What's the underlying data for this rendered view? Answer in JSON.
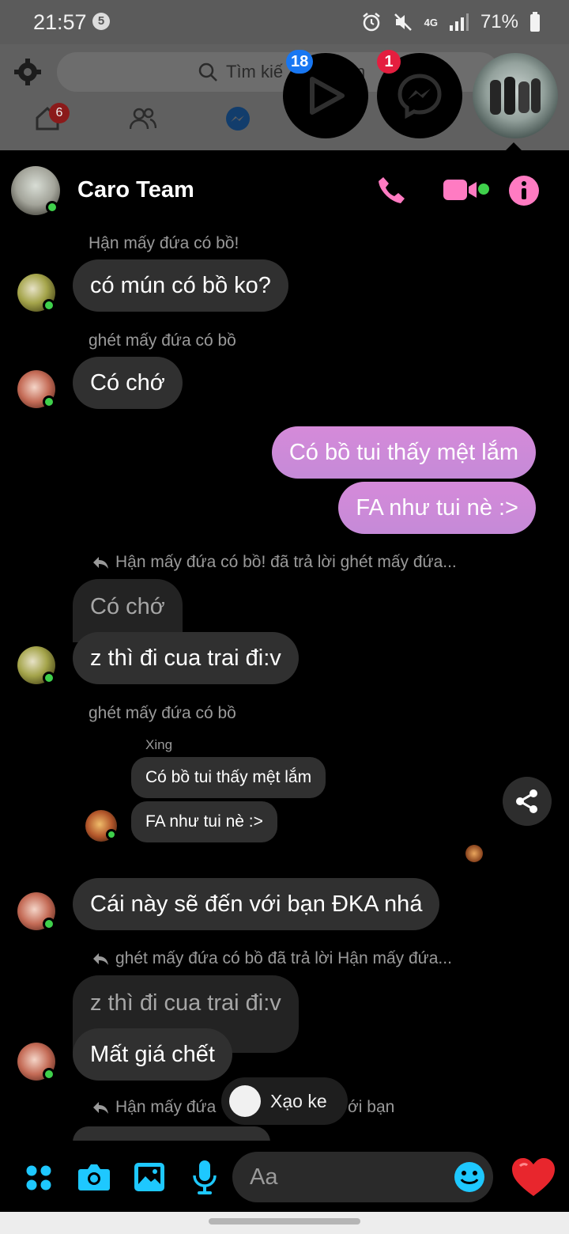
{
  "status_bar": {
    "time": "21:57",
    "notification_count": "5",
    "network": "4G",
    "battery": "71%"
  },
  "fb": {
    "search_text": "Tìm kiế",
    "search_text_tail": "n",
    "home_badge": "6"
  },
  "chat_heads": {
    "video_badge": "18",
    "messenger_badge": "1"
  },
  "chat": {
    "title": "Caro Team",
    "colors": {
      "accent": "#ff7bc2",
      "online": "#3fd04b",
      "mine_bubble": "#d58ad9",
      "icon_blue": "#1ec8ff"
    },
    "messages": [
      {
        "sender_meta": "Hận mấy đứa có bồ!",
        "text": "có mún có bồ ko?"
      },
      {
        "sender_meta": "ghét mấy đứa có bồ",
        "text": "Có chớ"
      },
      {
        "text": "Có bồ tui thấy mệt lắm",
        "mine": true
      },
      {
        "text": "FA như tui nè :>",
        "mine": true
      },
      {
        "reply_meta": "Hận mấy đứa có bồ! đã trả lời ghét mấy đứa...",
        "quoted": "Có chớ",
        "text": "z thì đi cua trai đi:v"
      },
      {
        "sender_meta": "ghét mấy đứa có bồ",
        "forward_author": "Xing",
        "forward_lines": [
          "Có bồ tui thấy mệt lắm",
          "FA như tui nè :>"
        ]
      },
      {
        "text": "Cái này sẽ đến với bạn ĐKA nhá"
      },
      {
        "reply_meta": "ghét mấy đứa có bồ đã trả lời Hận mấy đứa...",
        "quoted": "z thì đi cua trai đi:v",
        "text": "Mất giá chết"
      },
      {
        "reply_meta_part1": "Hận mấy đứa",
        "reply_meta_part2": "ới bạn"
      }
    ],
    "toast": "Xạo ke",
    "composer_placeholder": "Aa"
  }
}
